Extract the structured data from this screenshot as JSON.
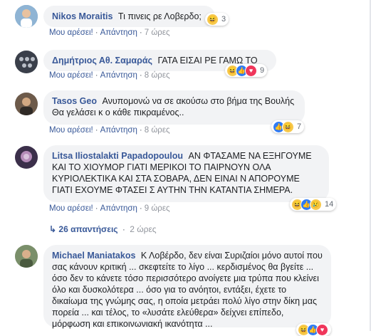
{
  "ui": {
    "like": "Μου αρέσει!",
    "reply": "Απάντηση",
    "sep": "·"
  },
  "comments": [
    {
      "author": "Nikos Moraitis",
      "text": "Τι πινεις ρε Λοβερδο;",
      "time": "7 ώρες",
      "reactions": {
        "icons": [
          "haha"
        ],
        "count": "3"
      }
    },
    {
      "author": "Δημήτριος Αθ. Σαμαράς",
      "text": "ΓΑΤΑ ΕΙΣΑΙ ΡΕ ΓΑΜΩ ΤΟ",
      "time": "8 ώρες",
      "reactions": {
        "icons": [
          "haha",
          "like",
          "love"
        ],
        "count": "9"
      }
    },
    {
      "author": "Tasos Geo",
      "text": "Ανυπομονώ να σε ακούσω στο βήμα της Βουλής Θα γελάσει κ ο κάθε πικραμένος..",
      "time": "8 ώρες",
      "reactions": {
        "icons": [
          "like",
          "haha"
        ],
        "count": "7"
      }
    },
    {
      "author": "Litsa Iliostalakti Papadopoulou",
      "text": "ΑΝ ΦΤΑΣΑΜΕ ΝΑ ΕΞΗΓΟΥΜΕ ΚΑΙ ΤΟ ΧΙΟΥΜΟΡ ΓΙΑΤΙ ΜΕΡΙΚΟΙ ΤΟ ΠΑΙΡΝΟΥΝ ΟΛΑ ΚΥΡΙΟΛΕΚΤΙΚΑ ΚΑΙ ΣΤΑ ΣΟΒΑΡΑ, ΔΕΝ ΕΙΝΑΙ Ν ΑΠΟΡΟΥΜΕ ΓΙΑΤΙ ΕΧΟΥΜΕ ΦΤΑΣΕΙ Σ ΑΥΤΗΝ ΤΗΝ ΚΑΤΑΝΤΙΑ ΣΗΜΕΡΑ.",
      "time": "9 ώρες",
      "reactions": {
        "icons": [
          "haha",
          "like",
          "sad"
        ],
        "count": "14"
      }
    },
    {
      "author": "Michael Maniatakos",
      "text": "Κ Λοβέρδο, δεν είναι Συριζαίοι μόνο αυτοί που σας κάνουν κριτική ... σκεφτείτε το λίγο ... κερδισμένος θα βγείτε ... όσο δεν το κάνετε τόσο περισσότερο ανοίγετε μια τρύπα που κλείνει όλο και δυσκολότερα ... όσο για το ανόητοι, εντάξει, έχετε το δικαίωμα της γνώμης σας, η οποία μετράει πολύ λίγο στην δίκη μας πορεία ... και τέλος, το «λυσάτε ελεύθερα» δείχνει επίπεδο, μόρφωση και επικοινωνιακή ικανότητα ...",
      "reactions": {
        "icons": [
          "haha",
          "like",
          "love"
        ],
        "count": ""
      }
    }
  ],
  "replies_link": {
    "icon": "↳",
    "label": "26 απαντήσεις",
    "time": "2 ώρες"
  }
}
